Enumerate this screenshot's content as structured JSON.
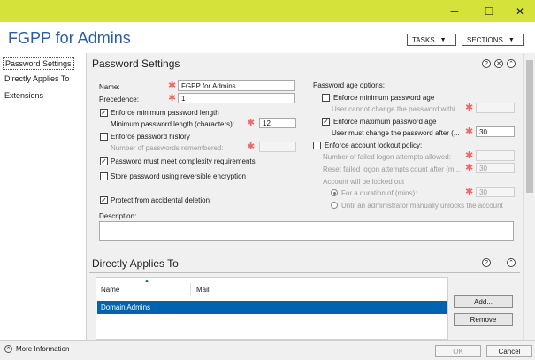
{
  "window": {
    "minimize": "─",
    "maximize": "☐",
    "close": "✕"
  },
  "header": {
    "title": "FGPP for Admins",
    "tasks": "TASKS",
    "sections": "SECTIONS"
  },
  "sidebar": {
    "items": [
      {
        "label": "Password Settings"
      },
      {
        "label": "Directly Applies To"
      },
      {
        "label": "Extensions"
      }
    ]
  },
  "password_settings": {
    "title": "Password Settings",
    "name_label": "Name:",
    "name_value": "FGPP for Admins",
    "precedence_label": "Precedence:",
    "precedence_value": "1",
    "enforce_min_length_label": "Enforce minimum password length",
    "min_length_label": "Minimum password length (characters):",
    "min_length_value": "12",
    "enforce_history_label": "Enforce password history",
    "remembered_label": "Number of passwords remembered:",
    "complexity_label": "Password must meet complexity requirements",
    "reversible_label": "Store password using reversible encryption",
    "protect_label": "Protect from accidental deletion",
    "description_label": "Description:",
    "age_options_label": "Password age options:",
    "enforce_min_age_label": "Enforce minimum password age",
    "cannot_change_label": "User cannot change the password withi...",
    "enforce_max_age_label": "Enforce maximum password age",
    "must_change_label": "User must change the password after (...",
    "must_change_value": "30",
    "lockout_policy_label": "Enforce account lockout policy:",
    "failed_attempts_label": "Number of failed logon attempts allowed:",
    "reset_count_label": "Reset failed logon attempts count after (m...",
    "reset_count_value": "30",
    "locked_out_label": "Account will be locked out",
    "duration_label": "For a duration of (mins):",
    "duration_value": "30",
    "manual_unlock_label": "Until an administrator manually unlocks the account",
    "checked": {
      "enforce_min_length": true,
      "enforce_history": false,
      "complexity": true,
      "reversible": false,
      "protect": true,
      "enforce_min_age": false,
      "enforce_max_age": true,
      "lockout_policy": false
    }
  },
  "applies_to": {
    "title": "Directly Applies To",
    "col_name": "Name",
    "col_mail": "Mail",
    "rows": [
      {
        "name": "Domain Admins",
        "mail": ""
      }
    ],
    "add_button": "Add...",
    "remove_button": "Remove"
  },
  "footer": {
    "more_info": "More Information",
    "ok": "OK",
    "cancel": "Cancel"
  },
  "colors": {
    "title_bar": "#d4e23a",
    "accent": "#0063b1",
    "title_text": "#2a5da8",
    "required": "#e66666"
  },
  "icons": [
    "help-icon",
    "close-section-icon",
    "collapse-icon",
    "info-circle-icon",
    "sort-arrow-icon"
  ]
}
